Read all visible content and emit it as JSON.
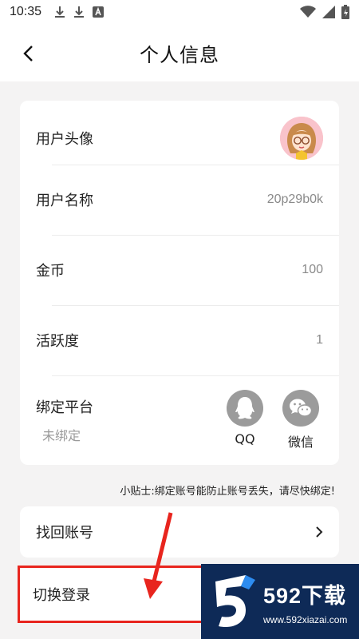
{
  "status_bar": {
    "time": "10:35",
    "left_icons": [
      "download-icon",
      "download-icon",
      "a-icon"
    ],
    "right_icons": [
      "wifi-icon",
      "signal-icon",
      "battery-icon"
    ]
  },
  "nav": {
    "title": "个人信息",
    "back_icon": "chevron-left-icon"
  },
  "profile": {
    "avatar_label": "用户头像",
    "username_label": "用户名称",
    "username_value": "20p29b0k",
    "coins_label": "金币",
    "coins_value": "100",
    "activity_label": "活跃度",
    "activity_value": "1",
    "bind_label": "绑定平台",
    "bind_status": "未绑定",
    "platforms": [
      {
        "label": "QQ",
        "icon": "qq-icon"
      },
      {
        "label": "微信",
        "icon": "wechat-icon"
      }
    ]
  },
  "tip": "小贴士:绑定账号能防止账号丢失，请尽快绑定!",
  "actions": {
    "recover_label": "找回账号",
    "switch_label": "切换登录"
  },
  "watermark": {
    "brand": "592下载",
    "url": "www.592xiazai.com"
  },
  "colors": {
    "highlight_red": "#e8251e",
    "watermark_bg": "#0e2a57"
  }
}
